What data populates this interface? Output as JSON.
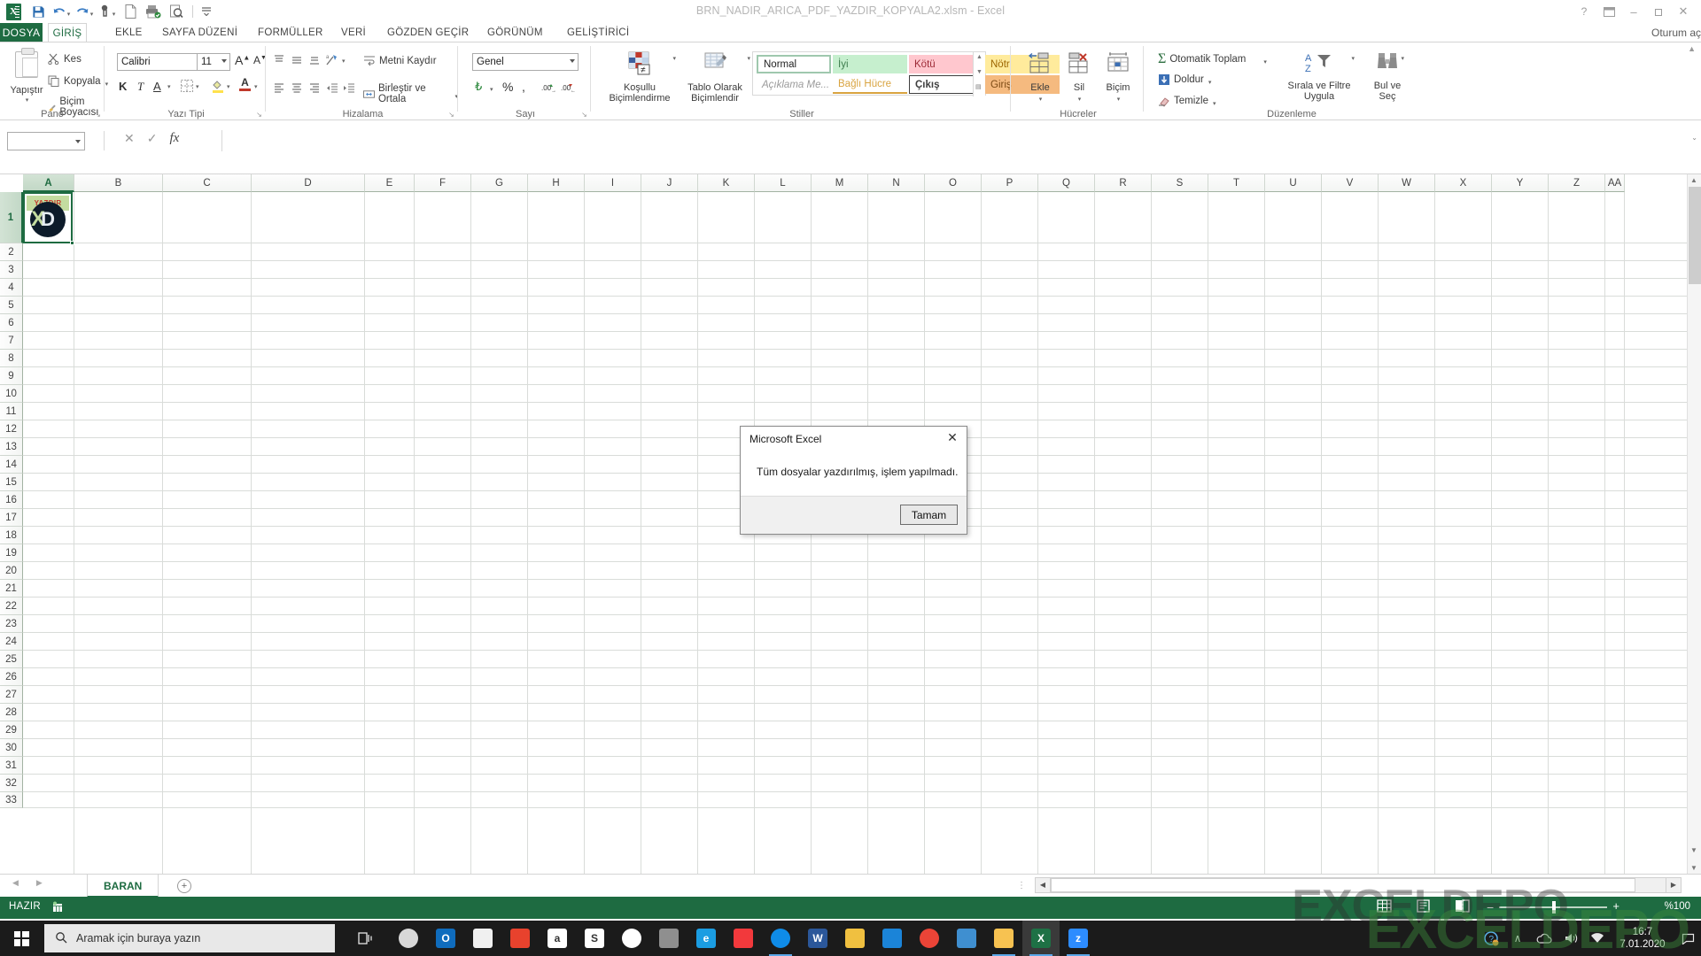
{
  "window": {
    "title": "BRN_NADIR_ARICA_PDF_YAZDIR_KOPYALA2.xlsm - Excel",
    "signin": "Oturum aç",
    "help_icon": "?",
    "minimize_icon": "–",
    "restore_icon": "❐",
    "close_icon": "✕"
  },
  "qat": {
    "save": "save-icon",
    "undo": "undo-icon",
    "redo": "redo-icon",
    "touch": "touch-mode-icon",
    "new": "new-file-icon",
    "print_quick": "quick-print-icon",
    "print_preview": "print-preview-icon",
    "customize": "customize-qat-icon"
  },
  "tabs": [
    {
      "label": "DOSYA",
      "kind": "file"
    },
    {
      "label": "GİRİŞ",
      "kind": "active"
    },
    {
      "label": "EKLE",
      "kind": "normal"
    },
    {
      "label": "SAYFA DÜZENİ",
      "kind": "normal"
    },
    {
      "label": "FORMÜLLER",
      "kind": "normal"
    },
    {
      "label": "VERİ",
      "kind": "normal"
    },
    {
      "label": "GÖZDEN GEÇİR",
      "kind": "normal"
    },
    {
      "label": "GÖRÜNÜM",
      "kind": "normal"
    },
    {
      "label": "GELİŞTİRİCİ",
      "kind": "normal"
    }
  ],
  "ribbon": {
    "groups": {
      "clipboard": {
        "name": "Pano",
        "paste": "Yapıştır",
        "cut": "Kes",
        "copy": "Kopyala",
        "format_painter": "Biçim Boyacısı"
      },
      "font": {
        "name": "Yazı Tipi",
        "font_family": "Calibri",
        "font_size": "11",
        "grow": "A",
        "shrink": "A",
        "bold": "K",
        "italic": "T",
        "underline": "A",
        "borders": "borders-icon",
        "fill": "fill-color-icon",
        "fontcolor": "font-color-icon"
      },
      "alignment": {
        "name": "Hizalama",
        "wrap": "Metni Kaydır",
        "merge": "Birleştir ve Ortala",
        "orientation": "orientation-icon"
      },
      "number": {
        "name": "Sayı",
        "format": "Genel",
        "currency": "currency-icon",
        "percent": "%",
        "comma": ",",
        "inc_dec": "increase-decimal-icon",
        "dec_dec": "decrease-decimal-icon"
      },
      "styles": {
        "name": "Stiller",
        "conditional": "Koşullu Biçimlendirme",
        "table": "Tablo Olarak Biçimlendir",
        "gallery": [
          {
            "label": "Normal",
            "style": "normal"
          },
          {
            "label": "İyi",
            "style": "good"
          },
          {
            "label": "Kötü",
            "style": "bad"
          },
          {
            "label": "Nötr",
            "style": "neutral"
          },
          {
            "label": "Açıklama Me...",
            "style": "note"
          },
          {
            "label": "Bağlı Hücre",
            "style": "linked"
          },
          {
            "label": "Çıkış",
            "style": "output"
          },
          {
            "label": "Giriş",
            "style": "input"
          }
        ]
      },
      "cells": {
        "name": "Hücreler",
        "insert": "Ekle",
        "delete": "Sil",
        "format": "Biçim"
      },
      "editing": {
        "name": "Düzenleme",
        "autosum": "Otomatik Toplam",
        "fill": "Doldur",
        "clear": "Temizle",
        "sort_filter": "Sırala ve Filtre Uygula",
        "find_select": "Bul ve Seç"
      }
    }
  },
  "formula_bar": {
    "namebox_value": "",
    "formula_value": "",
    "cancel_icon": "✕",
    "confirm_icon": "✓",
    "fx_icon": "fx",
    "expand_icon": "⌄"
  },
  "grid": {
    "columns": [
      "A",
      "B",
      "C",
      "D",
      "E",
      "F",
      "G",
      "H",
      "I",
      "J",
      "K",
      "L",
      "M",
      "N",
      "O",
      "P",
      "Q",
      "R",
      "S",
      "T",
      "U",
      "V",
      "W",
      "X",
      "Y",
      "Z",
      "AA"
    ],
    "rows": [
      "1",
      "2",
      "3",
      "4",
      "5",
      "6",
      "7",
      "8",
      "9",
      "10",
      "11",
      "12",
      "13",
      "14",
      "15",
      "16",
      "17",
      "18",
      "19",
      "20",
      "21",
      "22",
      "23",
      "24",
      "25",
      "26",
      "27",
      "28",
      "29",
      "30",
      "31",
      "32",
      "33"
    ],
    "selected_column": "A",
    "selected_row": "1",
    "shape_a1": {
      "label": "YAZDIR",
      "name": "yazdir-button-image",
      "band_color": "#c4dca0",
      "text_color": "#c0392b",
      "circle_color": "#0d1b2a"
    }
  },
  "sheets": {
    "tabs": [
      {
        "label": "BARAN",
        "active": true
      }
    ],
    "add_icon": "+",
    "prev_icon": "◀",
    "next_icon": "▶"
  },
  "status_bar": {
    "state": "HAZIR",
    "macro_icon": "record-macro-icon",
    "view_normal": "normal-view-icon",
    "view_layout": "page-layout-view-icon",
    "view_break": "page-break-view-icon",
    "zoom_out": "−",
    "zoom_in": "+",
    "zoom_value": "%100"
  },
  "dialog": {
    "title": "Microsoft Excel",
    "message": "Tüm dosyalar yazdırılmış, işlem yapılmadı.",
    "ok_label": "Tamam",
    "close_icon": "✕"
  },
  "taskbar": {
    "search_placeholder": "Aramak için buraya yazın",
    "start_icon": "windows-start-icon",
    "search_icon": "search-icon",
    "taskview_icon": "task-view-icon",
    "apps": [
      {
        "name": "cortana-icon",
        "glyph": "",
        "color": "#d8d8d8",
        "shape": "swirl"
      },
      {
        "name": "outlook-icon",
        "glyph": "O",
        "color": "#0f6cbd"
      },
      {
        "name": "microsoft-store-icon",
        "glyph": "",
        "color": "#f0f0f0",
        "shape": "bag"
      },
      {
        "name": "pdf-reader-icon",
        "glyph": "",
        "color": "#e8422d",
        "shape": "book"
      },
      {
        "name": "amazon-icon",
        "glyph": "a",
        "color": "#ffffff"
      },
      {
        "name": "snagit-icon",
        "glyph": "S",
        "color": "#ffffff",
        "shape": "s"
      },
      {
        "name": "dropbox-icon",
        "glyph": "",
        "color": "#ffffff",
        "shape": "dropbox"
      },
      {
        "name": "camera-icon",
        "glyph": "",
        "color": "#8f8f8f",
        "shape": "camera"
      },
      {
        "name": "internet-explorer-icon",
        "glyph": "e",
        "color": "#1b9de2"
      },
      {
        "name": "bandicam-icon",
        "glyph": "",
        "color": "#f2393c",
        "shape": "diamond"
      },
      {
        "name": "edge-icon",
        "glyph": "",
        "color": "#0f8ce8",
        "shape": "edge",
        "open": true
      },
      {
        "name": "word-icon",
        "glyph": "W",
        "color": "#2b579a"
      },
      {
        "name": "paint-icon",
        "glyph": "",
        "color": "#f0c040",
        "shape": "palette"
      },
      {
        "name": "mail-icon",
        "glyph": "",
        "color": "#1b84d8",
        "shape": "envelope"
      },
      {
        "name": "chrome-icon",
        "glyph": "",
        "color": "#eb4437",
        "shape": "chrome"
      },
      {
        "name": "calculator-icon",
        "glyph": "",
        "color": "#3f8fd0",
        "shape": "calc"
      },
      {
        "name": "file-explorer-icon",
        "glyph": "",
        "color": "#f7c251",
        "shape": "folder",
        "open": true
      },
      {
        "name": "excel-icon",
        "glyph": "X",
        "color": "#1e7145",
        "open": true,
        "active": true
      },
      {
        "name": "zoom-icon",
        "glyph": "z",
        "color": "#2d8cff",
        "open": true
      }
    ],
    "tray": {
      "chevron": "∧",
      "onedrive": "onedrive-icon",
      "volume": "volume-icon",
      "network": "network-icon",
      "help_badge": "help-badge-icon",
      "notification": "notification-icon",
      "time": "16:7",
      "date": "7.01.2020"
    },
    "watermark": "EXCELDEPO"
  }
}
